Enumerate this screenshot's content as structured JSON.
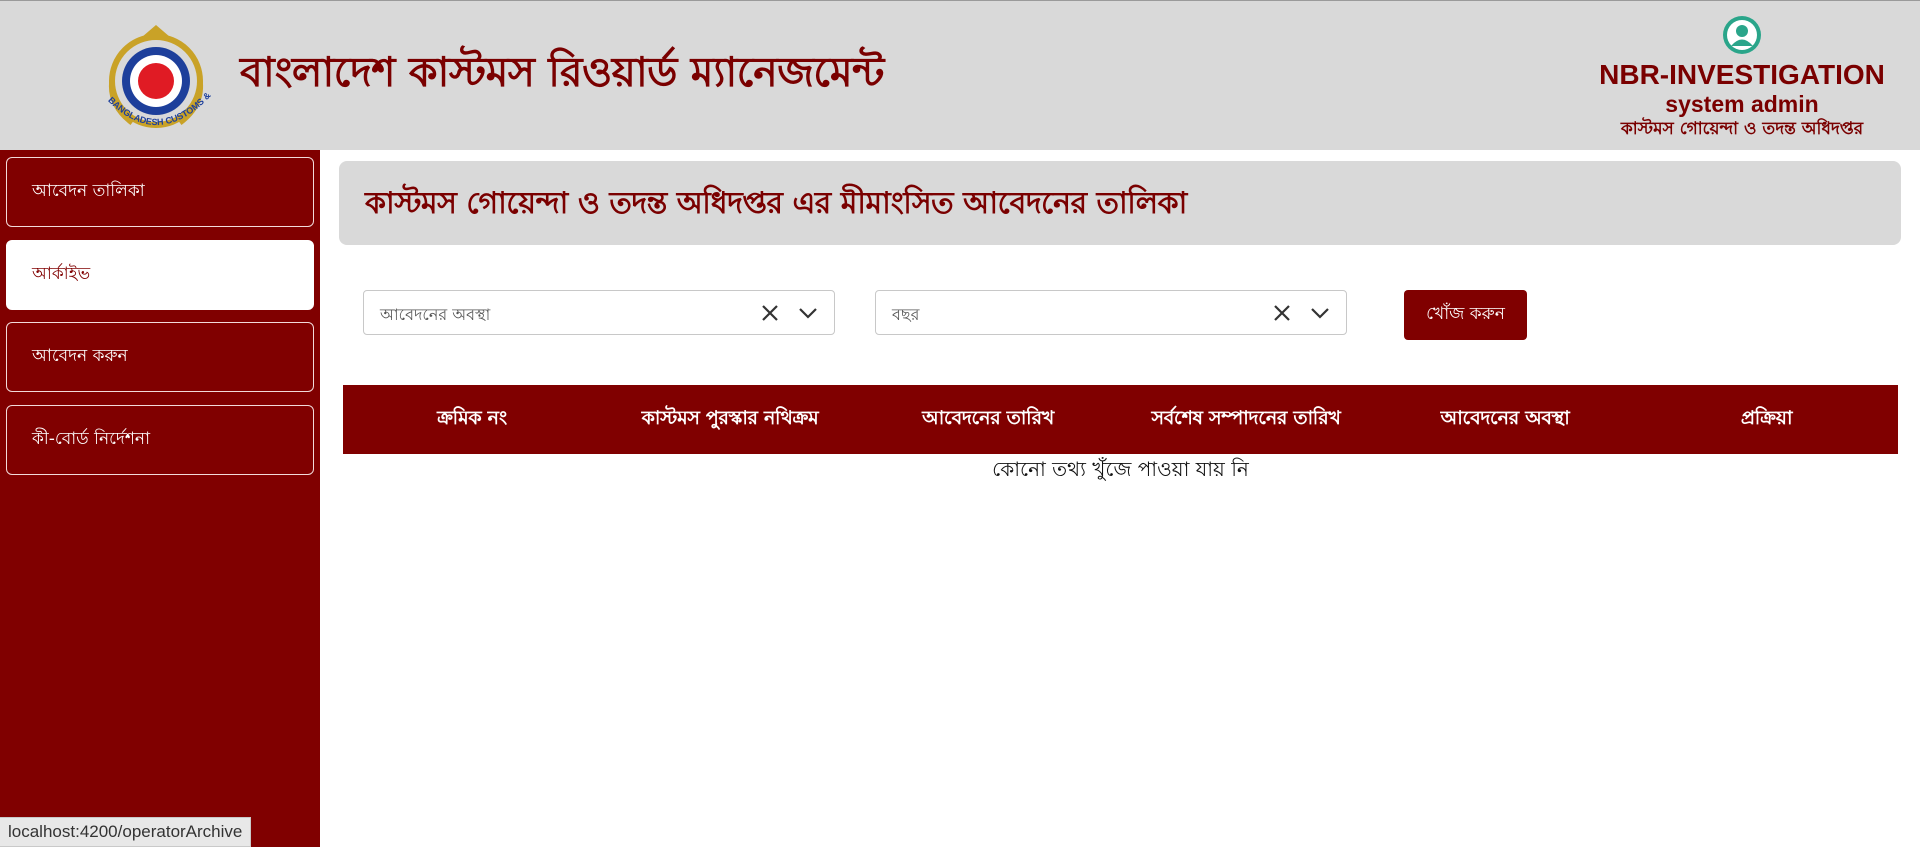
{
  "header": {
    "app_title": "বাংলাদেশ কাস্টমস রিওয়ার্ড ম্যানেজমেন্ট",
    "logo_text": "BANGLADESH CUSTOMS & VAT",
    "org_name": "NBR-INVESTIGATION",
    "user_role": "system admin",
    "user_dept": "কাস্টমস গোয়েন্দা ও তদন্ত অধিদপ্তর"
  },
  "sidebar": {
    "items": [
      {
        "label": "আবেদন তালিকা"
      },
      {
        "label": "আর্কাইভ"
      },
      {
        "label": "আবেদন করুন"
      },
      {
        "label": "কী-বোর্ড নির্দেশনা"
      }
    ],
    "active_index": 1
  },
  "main": {
    "title": "কাস্টমস গোয়েন্দা ও তদন্ত অধিদপ্তর এর মীমাংসিত আবেদনের তালিকা",
    "filters": {
      "status_placeholder": "আবেদনের অবস্থা",
      "year_placeholder": "বছর"
    },
    "search_label": "খোঁজ করুন",
    "table": {
      "columns": [
        "ক্রমিক নং",
        "কাস্টমস পুরস্কার নথিক্রম",
        "আবেদনের তারিখ",
        "সর্বশেষ সম্পাদনের তারিখ",
        "আবেদনের অবস্থা",
        "প্রক্রিয়া"
      ],
      "empty_text": "কোনো তথ্য খুঁজে পাওয়া যায় নি"
    }
  },
  "status_bar": {
    "url": "localhost:4200/operatorArchive"
  },
  "colors": {
    "brand": "#800000",
    "header_bg": "#d9d9d9"
  },
  "icons": [
    "customs-logo-icon",
    "user-avatar-icon",
    "clear-icon",
    "chevron-down-icon"
  ]
}
